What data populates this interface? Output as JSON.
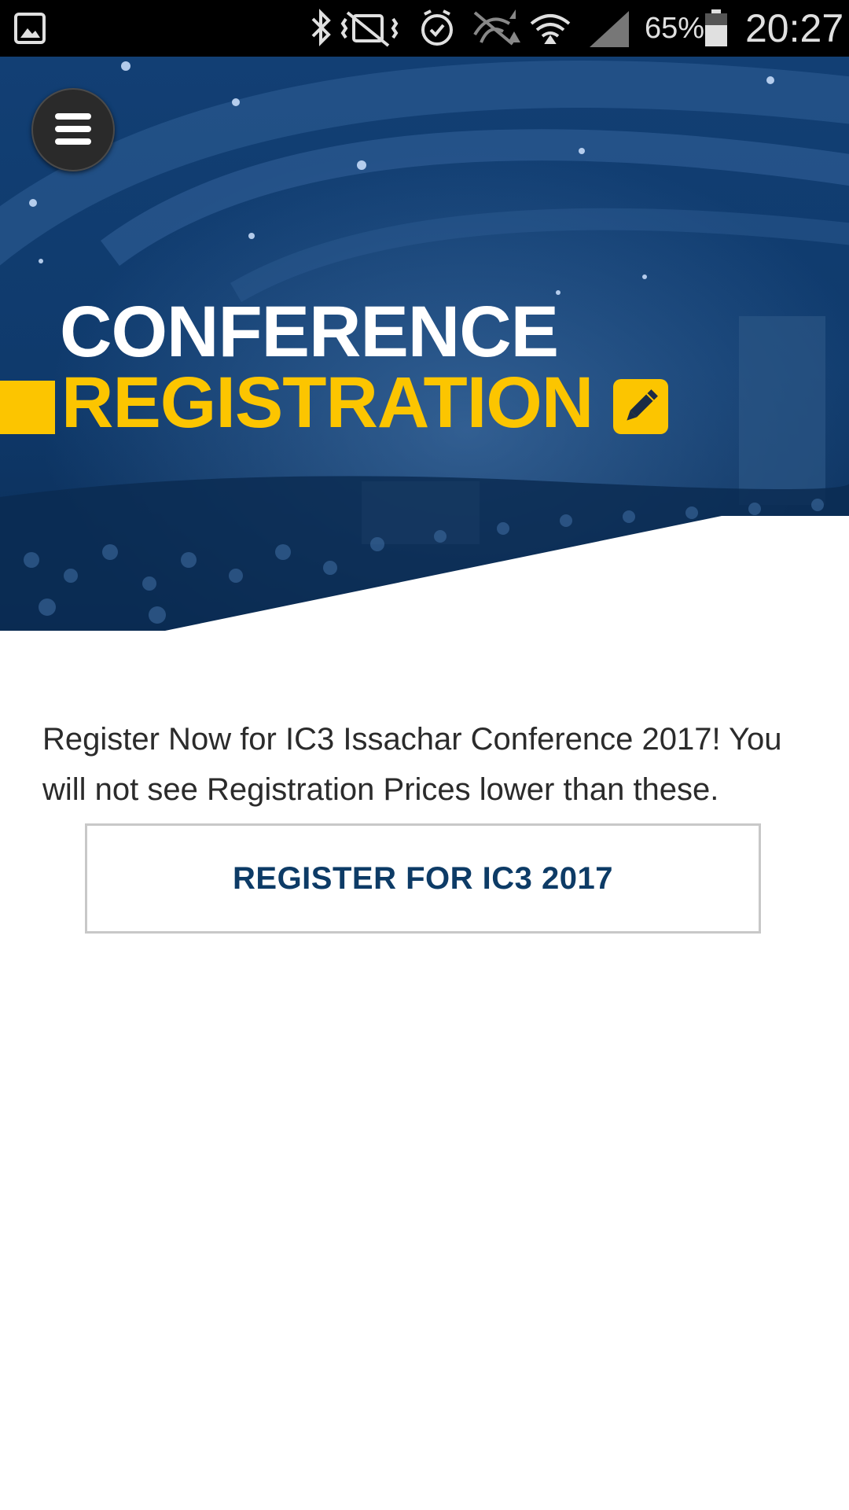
{
  "status_bar": {
    "battery_percent": "65%",
    "time": "20:27",
    "icons": [
      "gallery-icon",
      "bluetooth-icon",
      "vibrate-mute-icon",
      "alarm-icon",
      "data-off-icon",
      "wifi-icon",
      "signal-icon",
      "battery-icon"
    ]
  },
  "hero": {
    "title_line1": "CONFERENCE",
    "title_line2": "REGISTRATION",
    "menu_icon": "hamburger-menu-icon",
    "badge_icon": "pencil-icon",
    "colors": {
      "overlay_blue": "#0d3f7a",
      "accent_yellow": "#fcc500"
    }
  },
  "content": {
    "intro": "Register Now for IC3 Issachar Conference 2017! You will not see Registration Prices lower than these.",
    "register_button_label": "REGISTER FOR IC3 2017",
    "colors": {
      "button_text": "#0d3b66",
      "body_text": "#2b2b2b"
    }
  }
}
